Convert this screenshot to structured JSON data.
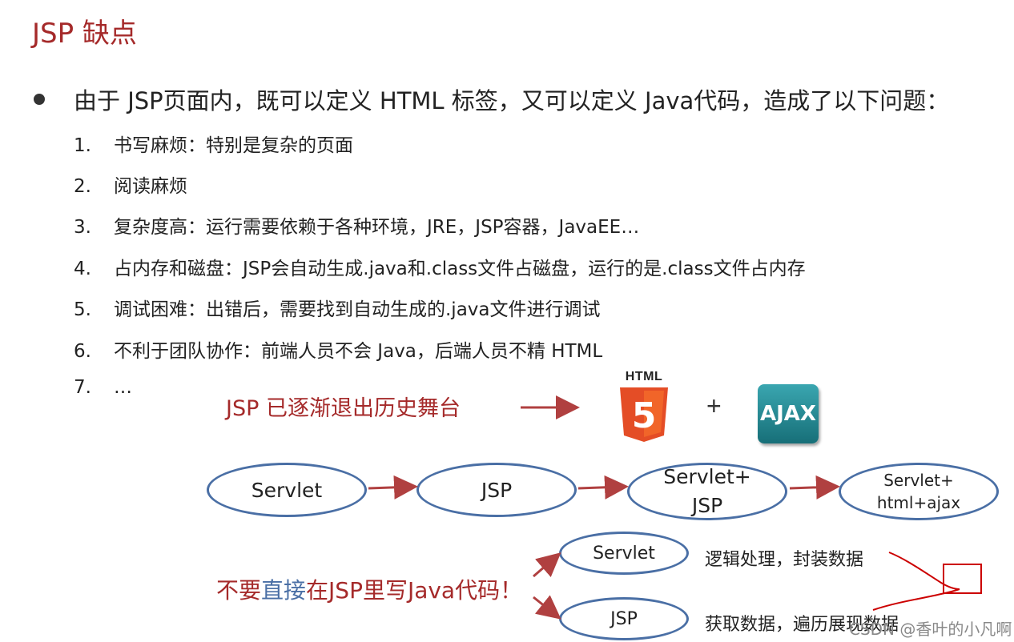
{
  "title": "JSP 缺点",
  "bullet": "由于 JSP页面内，既可以定义 HTML 标签，又可以定义 Java代码，造成了以下问题：",
  "items": [
    {
      "num": "1.",
      "text": "书写麻烦：特别是复杂的页面"
    },
    {
      "num": "2.",
      "text": "阅读麻烦"
    },
    {
      "num": "3.",
      "text": "复杂度高：运行需要依赖于各种环境，JRE，JSP容器，JavaEE…"
    },
    {
      "num": "4.",
      "text": "占内存和磁盘：JSP会自动生成.java和.class文件占磁盘，运行的是.class文件占内存"
    },
    {
      "num": "5.",
      "text": "调试困难：出错后，需要找到自动生成的.java文件进行调试"
    },
    {
      "num": "6.",
      "text": "不利于团队协作：前端人员不会 Java，后端人员不精 HTML"
    },
    {
      "num": "7.",
      "text": "…"
    }
  ],
  "retire": "JSP 已逐渐退出历史舞台",
  "html5_label": "HTML",
  "html5_digit": "5",
  "plus": "+",
  "ajax": "AJAX",
  "flow": [
    {
      "line1": "Servlet",
      "line2": ""
    },
    {
      "line1": "JSP",
      "line2": ""
    },
    {
      "line1": "Servlet+",
      "line2": "JSP"
    },
    {
      "line1": "Servlet+",
      "line2": "html+ajax"
    }
  ],
  "split": {
    "servlet": "Servlet",
    "jsp": "JSP",
    "servlet_desc": "逻辑处理，封装数据",
    "jsp_desc": "获取数据，遍历展现数据"
  },
  "dont": {
    "part1": "不要",
    "part2": "直接",
    "part3": "在JSP里写Java代码！"
  },
  "watermark": "CSDN @香叶的小凡啊",
  "colors": {
    "title": "#a52a2a",
    "ellipse_border": "#4a6fa5",
    "arrow": "#b04040",
    "html5": "#e44d26",
    "ajax": "#2a8c96"
  }
}
